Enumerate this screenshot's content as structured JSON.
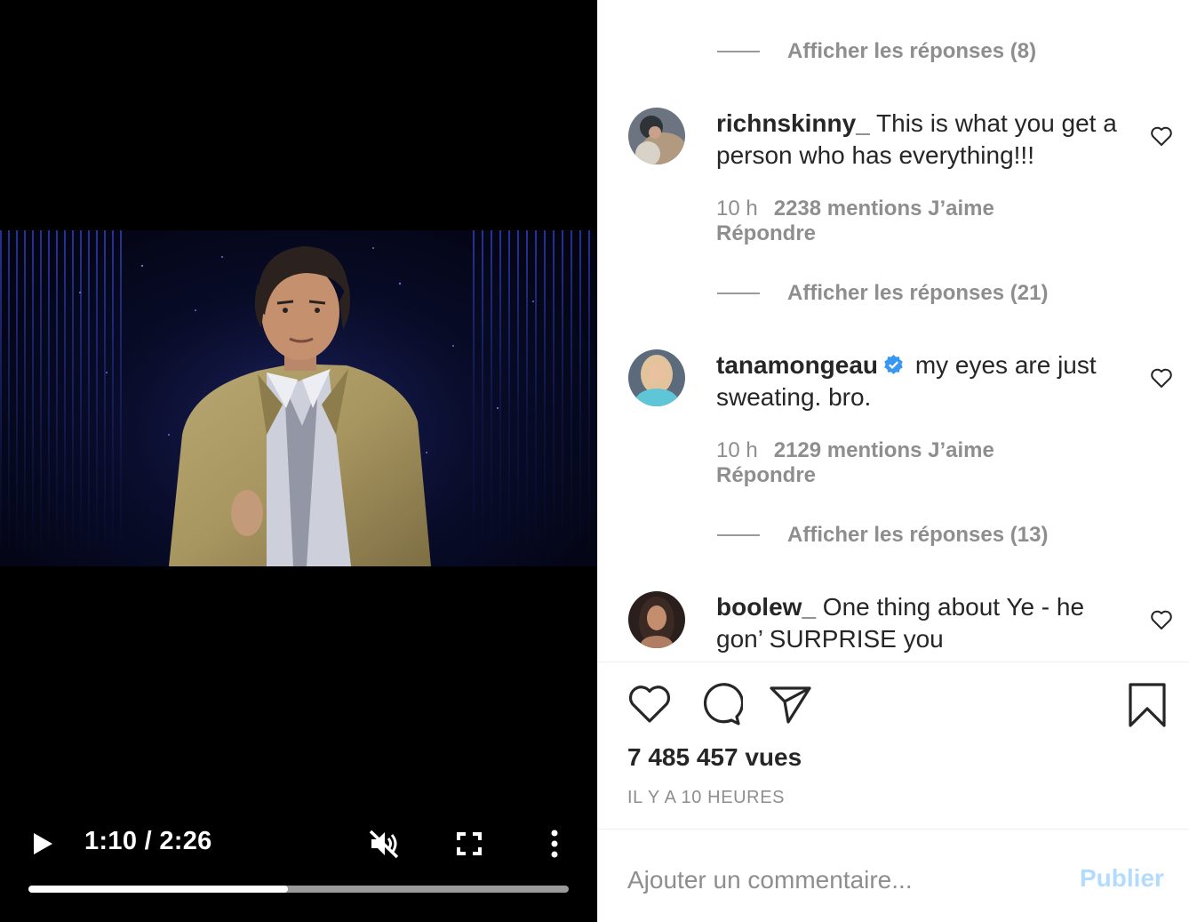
{
  "video": {
    "time": "1:10 / 2:26",
    "progress": 0.48,
    "icons": [
      "play-icon",
      "muted-speaker-icon",
      "fullscreen-icon",
      "more-vertical-icon"
    ]
  },
  "comments": [
    {
      "username": "richnskinny_",
      "verified": false,
      "text": "This is what you get a person who has everything!!!",
      "time": "10 h",
      "likes": "2238 mentions J’aime",
      "reply_label": "Répondre",
      "view_replies": "Afficher les réponses (21)"
    },
    {
      "username": "tanamongeau",
      "verified": true,
      "text": "my eyes are just sweating. bro.",
      "time": "10 h",
      "likes": "2129 mentions J’aime",
      "reply_label": "Répondre",
      "view_replies": "Afficher les réponses (13)"
    },
    {
      "username": "boolew_",
      "verified": false,
      "text": "One thing about Ye - he gon’ SURPRISE you"
    }
  ],
  "top_view_replies": "Afficher les réponses (8)",
  "actions": {
    "icons": [
      "heart-icon",
      "comment-icon",
      "share-icon",
      "bookmark-icon"
    ]
  },
  "stats": {
    "views": "7 485 457 vues",
    "age": "IL Y A 10 HEURES"
  },
  "composer": {
    "placeholder": "Ajouter un commentaire...",
    "publish_label": "Publier"
  },
  "colors": {
    "publish_disabled": "#b3dbff",
    "verified_badge": "#3897f0",
    "muted_text": "#8e8e8e"
  }
}
